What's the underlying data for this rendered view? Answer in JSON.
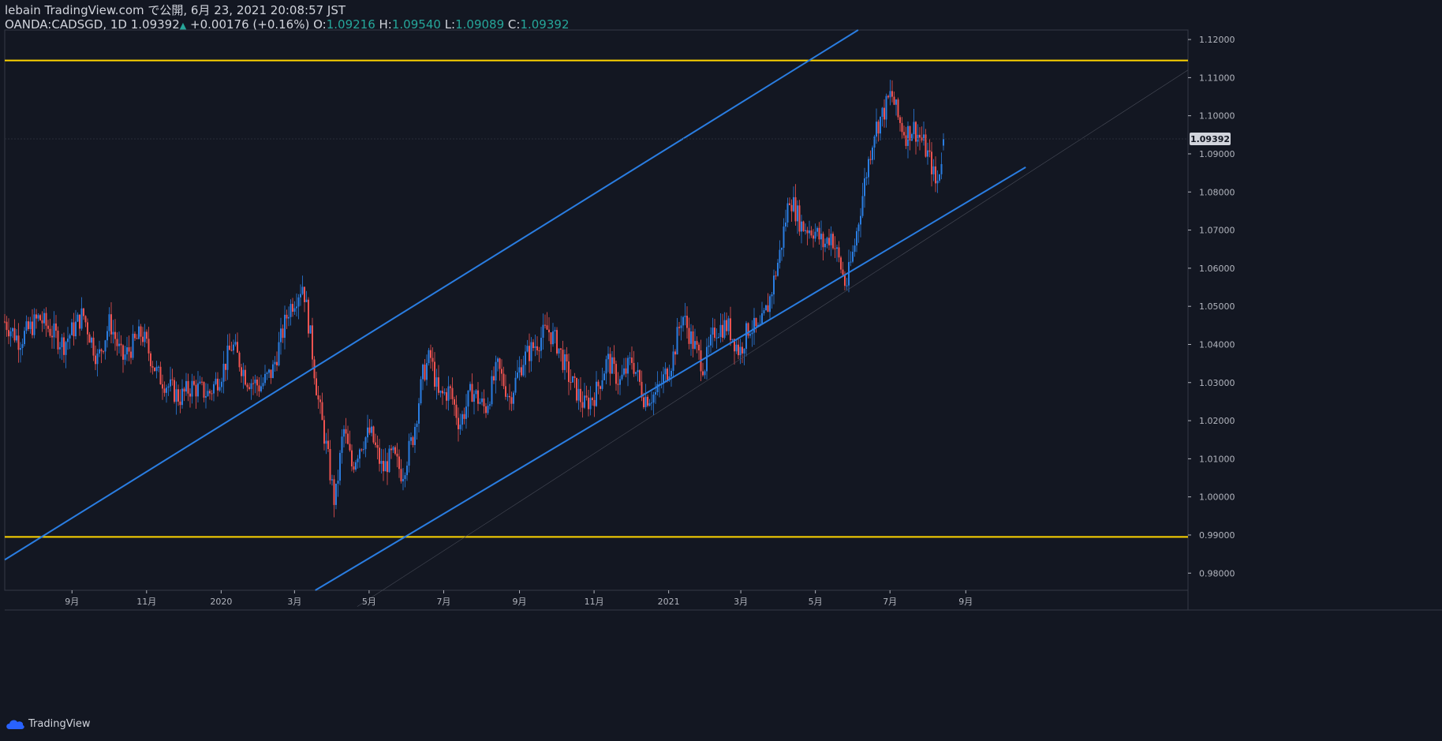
{
  "header": {
    "line1": "lebain TradingView.com で公開, 6月 23, 2021 20:08:57 JST",
    "symbol": "OANDA:CADSGD, 1D 1.09392",
    "change": "+0.00176 (+0.16%)",
    "o_label": "O:",
    "o_value": "1.09216",
    "h_label": "H:",
    "h_value": "1.09540",
    "l_label": "L:",
    "l_value": "1.09089",
    "c_label": "C:",
    "c_value": "1.09392"
  },
  "footer": {
    "brand": "TradingView"
  },
  "colors": {
    "background": "#131722",
    "up": "#2a7de1",
    "down": "#ef5350",
    "channel": "#2a7de1",
    "level": "#ffd500",
    "axis_text": "#b2b5be",
    "grid_border": "#363a45",
    "price_badge_bg": "#d1d4dc",
    "price_badge_text": "#131722"
  },
  "chart_data": {
    "type": "candlestick",
    "y_axis_ticks": [
      "1.12000",
      "1.11000",
      "1.10000",
      "1.09000",
      "1.08000",
      "1.07000",
      "1.06000",
      "1.05000",
      "1.04000",
      "1.03000",
      "1.02000",
      "1.01000",
      "1.00000",
      "0.99000",
      "0.98000"
    ],
    "ylim": [
      0.9755,
      1.1225
    ],
    "x_axis_ticks": [
      "9月",
      "11月",
      "2020",
      "3月",
      "5月",
      "7月",
      "9月",
      "11月",
      "2021",
      "3月",
      "5月",
      "7月",
      "9月"
    ],
    "last_price_label": "1.09392",
    "horizontal_levels": [
      1.1145,
      0.9895
    ],
    "channel_lines": [
      {
        "from": {
          "date": "2019-07-08",
          "price": 0.9835
        },
        "to": {
          "date": "2021-06-05",
          "price": 1.1225
        }
      },
      {
        "from": {
          "date": "2020-03-18",
          "price": 0.9755
        },
        "to": {
          "date": "2021-10-20",
          "price": 1.0865
        }
      }
    ],
    "candle_colors": "up = blue, down = red",
    "candle_anchors": [
      {
        "date": "2019-07-08",
        "price": 1.046
      },
      {
        "date": "2019-07-20",
        "price": 1.041
      },
      {
        "date": "2019-08-05",
        "price": 1.047
      },
      {
        "date": "2019-08-25",
        "price": 1.04
      },
      {
        "date": "2019-09-10",
        "price": 1.048
      },
      {
        "date": "2019-09-22",
        "price": 1.036
      },
      {
        "date": "2019-10-02",
        "price": 1.046
      },
      {
        "date": "2019-10-12",
        "price": 1.036
      },
      {
        "date": "2019-10-28",
        "price": 1.043
      },
      {
        "date": "2019-11-10",
        "price": 1.032
      },
      {
        "date": "2019-11-28",
        "price": 1.026
      },
      {
        "date": "2019-12-08",
        "price": 1.029
      },
      {
        "date": "2019-12-22",
        "price": 1.027
      },
      {
        "date": "2020-01-02",
        "price": 1.033
      },
      {
        "date": "2020-01-10",
        "price": 1.04
      },
      {
        "date": "2020-01-22",
        "price": 1.031
      },
      {
        "date": "2020-02-02",
        "price": 1.029
      },
      {
        "date": "2020-02-12",
        "price": 1.033
      },
      {
        "date": "2020-02-25",
        "price": 1.049
      },
      {
        "date": "2020-03-08",
        "price": 1.056
      },
      {
        "date": "2020-03-14",
        "price": 1.042
      },
      {
        "date": "2020-03-20",
        "price": 1.026
      },
      {
        "date": "2020-03-27",
        "price": 1.013
      },
      {
        "date": "2020-04-03",
        "price": 0.998
      },
      {
        "date": "2020-04-10",
        "price": 1.018
      },
      {
        "date": "2020-04-17",
        "price": 1.008
      },
      {
        "date": "2020-04-24",
        "price": 1.014
      },
      {
        "date": "2020-05-02",
        "price": 1.017
      },
      {
        "date": "2020-05-12",
        "price": 1.007
      },
      {
        "date": "2020-05-20",
        "price": 1.011
      },
      {
        "date": "2020-05-28",
        "price": 1.006
      },
      {
        "date": "2020-06-06",
        "price": 1.016
      },
      {
        "date": "2020-06-14",
        "price": 1.032
      },
      {
        "date": "2020-06-20",
        "price": 1.037
      },
      {
        "date": "2020-06-27",
        "price": 1.026
      },
      {
        "date": "2020-07-06",
        "price": 1.028
      },
      {
        "date": "2020-07-14",
        "price": 1.019
      },
      {
        "date": "2020-07-24",
        "price": 1.028
      },
      {
        "date": "2020-08-04",
        "price": 1.023
      },
      {
        "date": "2020-08-14",
        "price": 1.034
      },
      {
        "date": "2020-08-24",
        "price": 1.026
      },
      {
        "date": "2020-09-04",
        "price": 1.036
      },
      {
        "date": "2020-09-14",
        "price": 1.04
      },
      {
        "date": "2020-09-24",
        "price": 1.044
      },
      {
        "date": "2020-10-02",
        "price": 1.04
      },
      {
        "date": "2020-10-12",
        "price": 1.031
      },
      {
        "date": "2020-10-24",
        "price": 1.024
      },
      {
        "date": "2020-11-02",
        "price": 1.027
      },
      {
        "date": "2020-11-12",
        "price": 1.036
      },
      {
        "date": "2020-11-22",
        "price": 1.03
      },
      {
        "date": "2020-12-02",
        "price": 1.036
      },
      {
        "date": "2020-12-12",
        "price": 1.026
      },
      {
        "date": "2020-12-22",
        "price": 1.027
      },
      {
        "date": "2021-01-04",
        "price": 1.036
      },
      {
        "date": "2021-01-12",
        "price": 1.048
      },
      {
        "date": "2021-01-20",
        "price": 1.041
      },
      {
        "date": "2021-01-30",
        "price": 1.034
      },
      {
        "date": "2021-02-08",
        "price": 1.044
      },
      {
        "date": "2021-02-18",
        "price": 1.045
      },
      {
        "date": "2021-02-28",
        "price": 1.038
      },
      {
        "date": "2021-03-08",
        "price": 1.045
      },
      {
        "date": "2021-03-16",
        "price": 1.043
      },
      {
        "date": "2021-03-24",
        "price": 1.051
      },
      {
        "date": "2021-04-02",
        "price": 1.064
      },
      {
        "date": "2021-04-10",
        "price": 1.079
      },
      {
        "date": "2021-04-20",
        "price": 1.071
      },
      {
        "date": "2021-04-30",
        "price": 1.07
      },
      {
        "date": "2021-05-08",
        "price": 1.066
      },
      {
        "date": "2021-05-14",
        "price": 1.069
      },
      {
        "date": "2021-05-22",
        "price": 1.06
      },
      {
        "date": "2021-05-26",
        "price": 1.055
      },
      {
        "date": "2021-06-02",
        "price": 1.066
      },
      {
        "date": "2021-06-10",
        "price": 1.082
      },
      {
        "date": "2021-06-18",
        "price": 1.096
      },
      {
        "date": "2021-06-26",
        "price": 1.101
      },
      {
        "date": "2021-07-02",
        "price": 1.106
      },
      {
        "date": "2021-07-08",
        "price": 1.099
      },
      {
        "date": "2021-07-14",
        "price": 1.095
      },
      {
        "date": "2021-07-20",
        "price": 1.097
      },
      {
        "date": "2021-07-28",
        "price": 1.093
      },
      {
        "date": "2021-08-04",
        "price": 1.087
      },
      {
        "date": "2021-08-08",
        "price": 1.081
      },
      {
        "date": "2021-08-14",
        "price": 1.093
      }
    ]
  }
}
